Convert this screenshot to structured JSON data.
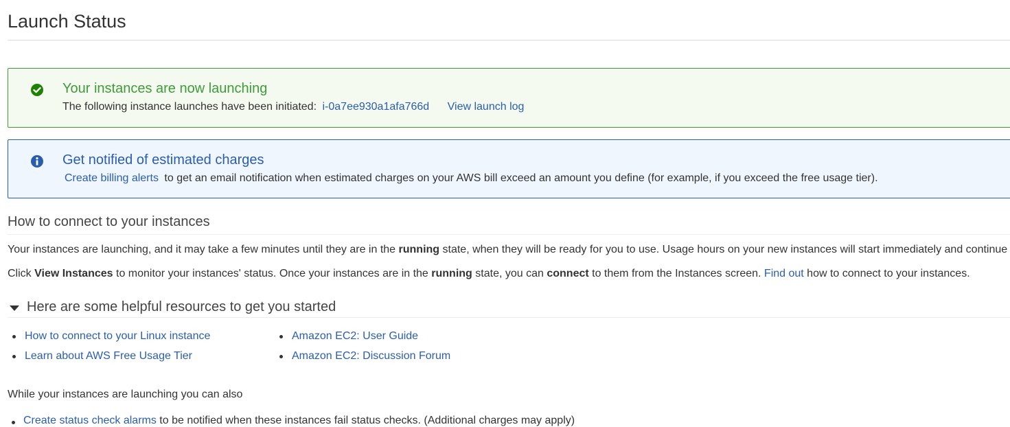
{
  "page": {
    "title": "Launch Status"
  },
  "success_alert": {
    "heading": "Your instances are now launching",
    "text_prefix": "The following instance launches have been initiated:",
    "instance_id": "i-0a7ee930a1afa766d",
    "view_log": "View launch log",
    "icon": "check-circle-icon",
    "color": "#3f9b3a"
  },
  "info_alert": {
    "heading": "Get notified of estimated charges",
    "link": "Create billing alerts",
    "text": "to get an email notification when estimated charges on your AWS bill exceed an amount you define (for example, if you exceed the free usage tier).",
    "icon": "info-circle-icon",
    "color": "#2a5db0"
  },
  "connect": {
    "heading": "How to connect to your instances",
    "p1": {
      "a": "Your instances are launching, and it may take a few minutes until they are in the ",
      "b": "running",
      "c": " state, when they will be ready for you to use. Usage hours on your new instances will start immediately and continue to a"
    },
    "p2": {
      "a": "Click ",
      "b": "View Instances",
      "c": " to monitor your instances' status. Once your instances are in the ",
      "d": "running",
      "e": " state, you can ",
      "f": "connect",
      "g": " to them from the Instances screen. ",
      "link": "Find out",
      "h": " how to connect to your instances."
    }
  },
  "resources": {
    "heading": "Here are some helpful resources to get you started",
    "left": [
      "How to connect to your Linux instance",
      "Learn about AWS Free Usage Tier"
    ],
    "right": [
      "Amazon EC2: User Guide",
      "Amazon EC2: Discussion Forum"
    ]
  },
  "also": {
    "heading": "While your instances are launching you can also",
    "item_link": "Create status check alarms",
    "item_text": " to be notified when these instances fail status checks. (Additional charges may apply)"
  }
}
